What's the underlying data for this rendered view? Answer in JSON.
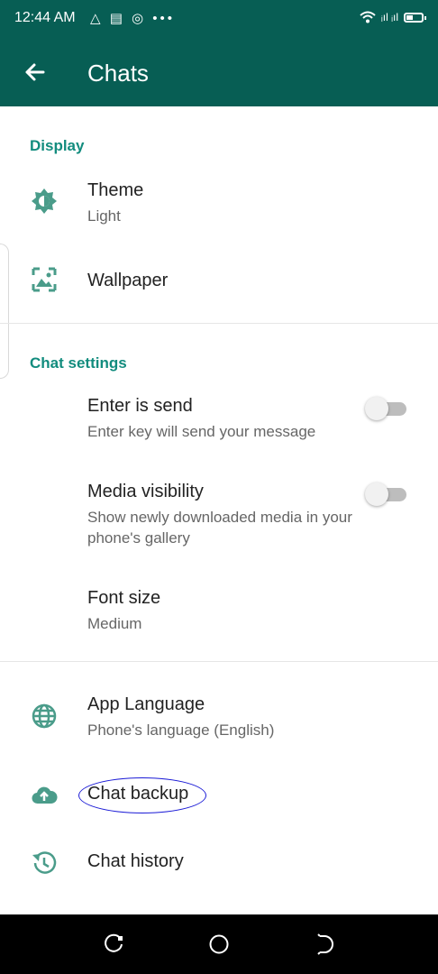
{
  "status_bar": {
    "time": "12:44 AM",
    "left_icons": "△ ▤ ◎ •••",
    "signal_text": "ᵢıl ᵢıl"
  },
  "app_bar": {
    "title": "Chats"
  },
  "display_section": {
    "header": "Display",
    "theme": {
      "title": "Theme",
      "subtitle": "Light"
    },
    "wallpaper": {
      "title": "Wallpaper"
    }
  },
  "chat_settings_section": {
    "header": "Chat settings",
    "enter_is_send": {
      "title": "Enter is send",
      "subtitle": "Enter key will send your message",
      "enabled": false
    },
    "media_visibility": {
      "title": "Media visibility",
      "subtitle": "Show newly downloaded media in your phone's gallery",
      "enabled": false
    },
    "font_size": {
      "title": "Font size",
      "subtitle": "Medium"
    }
  },
  "more_section": {
    "app_language": {
      "title": "App Language",
      "subtitle": "Phone's language (English)"
    },
    "chat_backup": {
      "title": "Chat backup"
    },
    "chat_history": {
      "title": "Chat history"
    }
  },
  "colors": {
    "primary_dark": "#075e54",
    "accent": "#128c7e",
    "icon": "#4a9c8a",
    "highlight_ellipse": "#1a1ad6"
  },
  "icons": {
    "back": "arrow-left-icon",
    "theme": "brightness-icon",
    "wallpaper": "wallpaper-icon",
    "language": "globe-icon",
    "backup": "cloud-upload-icon",
    "history": "history-icon"
  }
}
